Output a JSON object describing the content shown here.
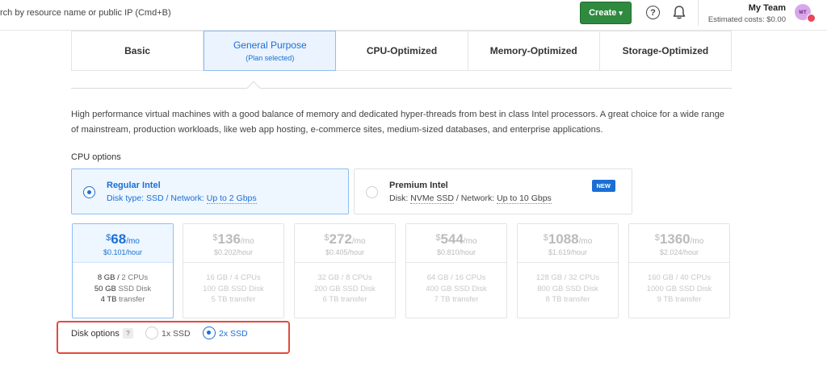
{
  "header": {
    "search_placeholder": "rch by resource name or public IP (Cmd+B)",
    "create_label": "Create",
    "team_name": "My Team",
    "estimated_costs": "Estimated costs: $0.00",
    "avatar_initials": "MT",
    "accent_green": "#2f8a3f"
  },
  "plan_tabs": [
    {
      "label": "Basic"
    },
    {
      "label": "General Purpose",
      "sub": "(Plan selected)"
    },
    {
      "label": "CPU-Optimized"
    },
    {
      "label": "Memory-Optimized"
    },
    {
      "label": "Storage-Optimized"
    }
  ],
  "description": "High performance virtual machines with a good balance of memory and dedicated hyper-threads from best in class Intel processors. A great choice for a wide range of mainstream, production workloads, like web app hosting, e-commerce sites, medium-sized databases, and enterprise applications.",
  "cpu_options": {
    "title": "CPU options",
    "items": [
      {
        "name": "Regular Intel",
        "disk_label": "Disk type:",
        "disk_value": "SSD",
        "net_label": "Network:",
        "net_value": "Up to 2 Gbps"
      },
      {
        "name": "Premium Intel",
        "disk_label": "Disk:",
        "disk_value": "NVMe SSD",
        "net_label": "Network:",
        "net_value": "Up to 10 Gbps",
        "badge": "NEW"
      }
    ]
  },
  "prices": [
    {
      "currency": "$",
      "amount": "68",
      "per": "/mo",
      "hourly": "$0.101",
      "hour_unit": "/hour",
      "mem": "8 GB",
      "cpus": "2 CPUs",
      "disk_size": "50 GB",
      "disk_type": "SSD Disk",
      "transfer": "4 TB",
      "transfer_unit": "transfer"
    },
    {
      "currency": "$",
      "amount": "136",
      "per": "/mo",
      "hourly": "$0.202",
      "hour_unit": "/hour",
      "mem": "16 GB",
      "cpus": "4 CPUs",
      "disk_size": "100 GB",
      "disk_type": "SSD Disk",
      "transfer": "5 TB",
      "transfer_unit": "transfer"
    },
    {
      "currency": "$",
      "amount": "272",
      "per": "/mo",
      "hourly": "$0.405",
      "hour_unit": "/hour",
      "mem": "32 GB",
      "cpus": "8 CPUs",
      "disk_size": "200 GB",
      "disk_type": "SSD Disk",
      "transfer": "6 TB",
      "transfer_unit": "transfer"
    },
    {
      "currency": "$",
      "amount": "544",
      "per": "/mo",
      "hourly": "$0.810",
      "hour_unit": "/hour",
      "mem": "64 GB",
      "cpus": "16 CPUs",
      "disk_size": "400 GB",
      "disk_type": "SSD Disk",
      "transfer": "7 TB",
      "transfer_unit": "transfer"
    },
    {
      "currency": "$",
      "amount": "1088",
      "per": "/mo",
      "hourly": "$1.619",
      "hour_unit": "/hour",
      "mem": "128 GB",
      "cpus": "32 CPUs",
      "disk_size": "800 GB",
      "disk_type": "SSD Disk",
      "transfer": "8 TB",
      "transfer_unit": "transfer"
    },
    {
      "currency": "$",
      "amount": "1360",
      "per": "/mo",
      "hourly": "$2.024",
      "hour_unit": "/hour",
      "mem": "160 GB",
      "cpus": "40 CPUs",
      "disk_size": "1000 GB",
      "disk_type": "SSD Disk",
      "transfer": "9 TB",
      "transfer_unit": "transfer"
    }
  ],
  "disk_options": {
    "label": "Disk options",
    "help": "?",
    "option_1": "1x SSD",
    "option_2": "2x SSD",
    "highlight_color": "#e24a3c"
  },
  "colors": {
    "accent_blue": "#1a6fd4"
  }
}
